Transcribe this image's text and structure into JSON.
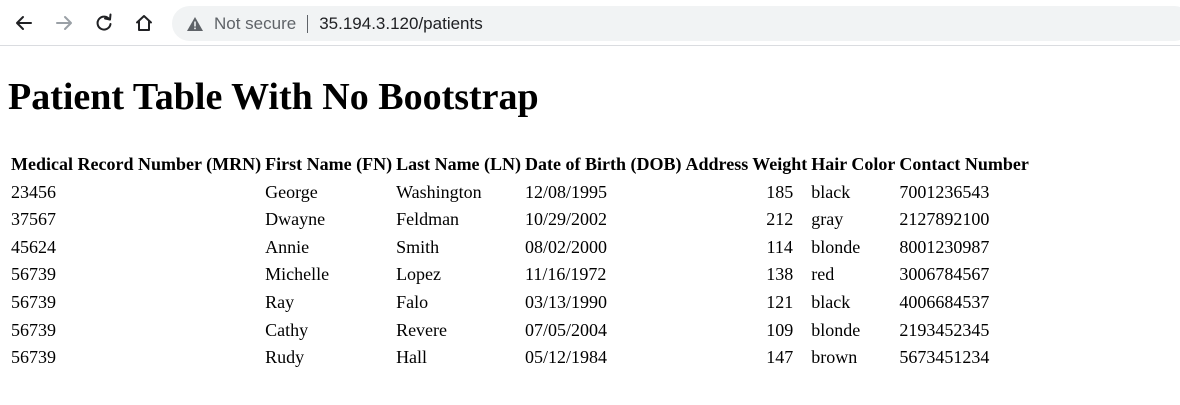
{
  "browser": {
    "security_label": "Not secure",
    "url": "35.194.3.120/patients"
  },
  "page": {
    "title": "Patient Table With No Bootstrap"
  },
  "table": {
    "headers": [
      "Medical Record Number (MRN)",
      "First Name (FN)",
      "Last Name (LN)",
      "Date of Birth (DOB)",
      "Address",
      "Weight",
      "Hair Color",
      "Contact Number"
    ],
    "rows": [
      [
        "23456",
        "George",
        "Washington",
        "12/08/1995",
        "",
        "185",
        "black",
        "7001236543"
      ],
      [
        "37567",
        "Dwayne",
        "Feldman",
        "10/29/2002",
        "",
        "212",
        "gray",
        "2127892100"
      ],
      [
        "45624",
        "Annie",
        "Smith",
        "08/02/2000",
        "",
        "114",
        "blonde",
        "8001230987"
      ],
      [
        "56739",
        "Michelle",
        "Lopez",
        "11/16/1972",
        "",
        "138",
        "red",
        "3006784567"
      ],
      [
        "56739",
        "Ray",
        "Falo",
        "03/13/1990",
        "",
        "121",
        "black",
        "4006684537"
      ],
      [
        "56739",
        "Cathy",
        "Revere",
        "07/05/2004",
        "",
        "109",
        "blonde",
        "2193452345"
      ],
      [
        "56739",
        "Rudy",
        "Hall",
        "05/12/1984",
        "",
        "147",
        "brown",
        "5673451234"
      ]
    ]
  },
  "icons": {
    "back": "arrow-left-icon",
    "forward": "arrow-right-icon",
    "reload": "reload-icon",
    "home": "home-icon",
    "security": "warning-triangle-icon"
  }
}
